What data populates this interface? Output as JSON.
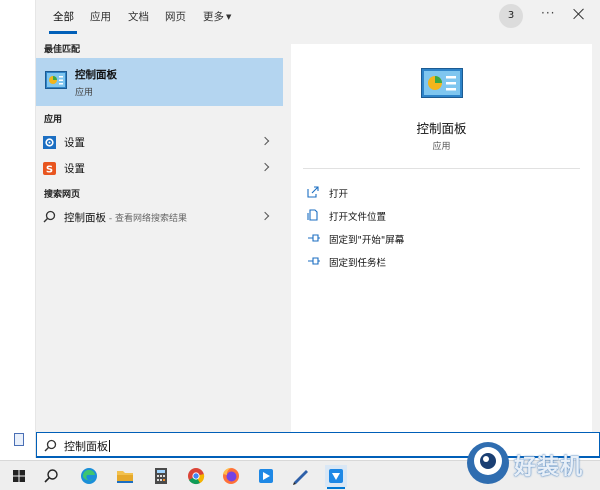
{
  "tabs": [
    {
      "label": "全部",
      "active": true
    },
    {
      "label": "应用"
    },
    {
      "label": "文档"
    },
    {
      "label": "网页"
    },
    {
      "label": "更多"
    }
  ],
  "header": {
    "badge_count": "3",
    "more_icon": "ellipsis-icon",
    "close_icon": "close-icon"
  },
  "sections": {
    "best_match": "最佳匹配",
    "apps": "应用",
    "web": "搜索网页"
  },
  "best_match": {
    "title": "控制面板",
    "subtitle": "应用",
    "icon": "control-panel-icon"
  },
  "apps": [
    {
      "label": "设置",
      "icon": "settings-gear-icon",
      "icon_color": "#1b6ec2"
    },
    {
      "label": "设置",
      "icon": "sogou-s-icon",
      "icon_color": "#e8551f"
    }
  ],
  "web": {
    "label": "控制面板",
    "hint": " - 查看网络搜索结果",
    "icon": "search-icon"
  },
  "detail": {
    "title": "控制面板",
    "subtitle": "应用",
    "actions": [
      {
        "label": "打开",
        "icon": "open-icon"
      },
      {
        "label": "打开文件位置",
        "icon": "file-location-icon"
      },
      {
        "label": "固定到\"开始\"屏幕",
        "icon": "pin-icon"
      },
      {
        "label": "固定到任务栏",
        "icon": "pin-icon"
      }
    ]
  },
  "search": {
    "value": "控制面板"
  },
  "taskbar": [
    "windows-start-icon",
    "search-icon",
    "edge-icon",
    "file-explorer-icon",
    "calculator-icon",
    "chrome-icon",
    "firefox-icon",
    "app-blue-icon",
    "pen-tool-icon",
    "active-app-icon"
  ],
  "watermark": {
    "text": "好装机"
  },
  "colors": {
    "accent": "#005fb8",
    "selection": "#b4d5f0",
    "panel_bg": "#f1f1f1"
  }
}
